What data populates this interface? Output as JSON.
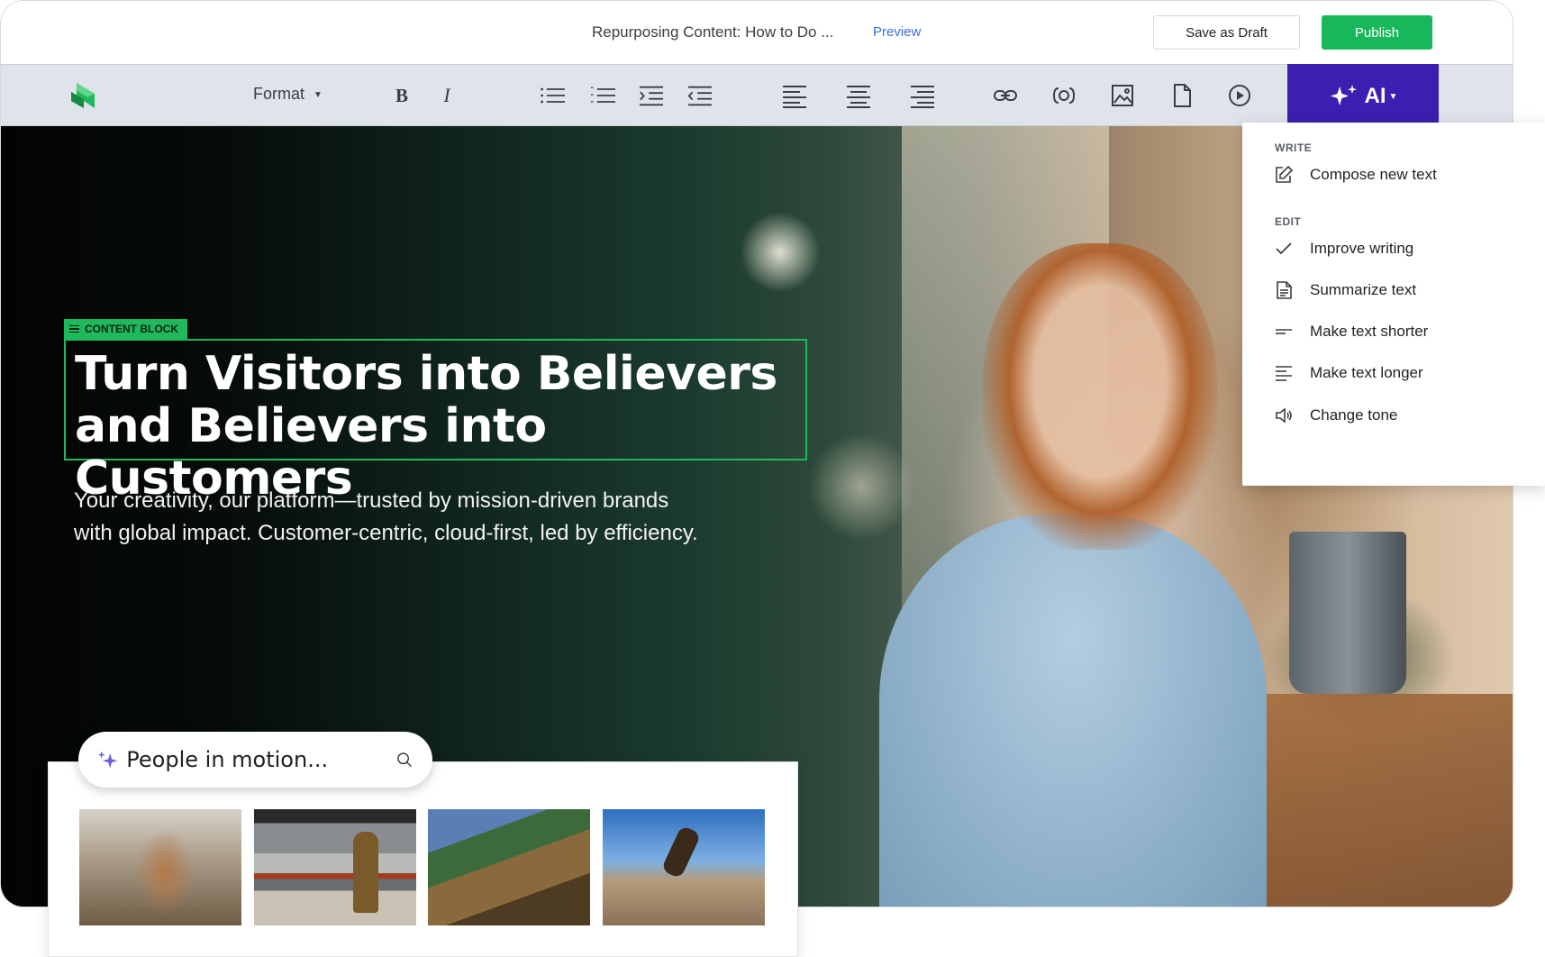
{
  "topbar": {
    "document_title": "Repurposing Content: How to Do ...",
    "preview_label": "Preview",
    "save_draft_label": "Save as Draft",
    "publish_label": "Publish"
  },
  "toolbar": {
    "format_label": "Format",
    "bold_glyph": "B",
    "italic_glyph": "I",
    "ai_label": "AI",
    "icons": [
      "bullet-list",
      "numbered-list",
      "indent",
      "outdent",
      "align-left",
      "align-center",
      "align-right",
      "link",
      "embed",
      "image",
      "document",
      "video"
    ]
  },
  "hero": {
    "tag_label": "CONTENT BLOCK",
    "headline_line1": "Turn Visitors into Believers",
    "headline_line2": "and Believers into Customers",
    "subtext_line1": "Your creativity, our platform—trusted by mission-driven brands",
    "subtext_line2": "with global impact. Customer-centric, cloud-first, led by efficiency."
  },
  "ai_menu": {
    "write_heading": "WRITE",
    "edit_heading": "EDIT",
    "items": [
      {
        "label": "Compose new text",
        "icon": "compose-icon"
      },
      {
        "label": "Improve writing",
        "icon": "check-icon"
      },
      {
        "label": "Summarize text",
        "icon": "summarize-icon"
      },
      {
        "label": "Make text shorter",
        "icon": "shorten-icon"
      },
      {
        "label": "Make text longer",
        "icon": "lengthen-icon"
      },
      {
        "label": "Change tone",
        "icon": "speaker-icon"
      }
    ]
  },
  "image_search": {
    "query": "People in motion...",
    "results": [
      "woman-with-bicycle-in-city",
      "woman-at-subway-platform",
      "person-with-bike-at-structure",
      "skateboarder-jumping"
    ]
  },
  "colors": {
    "accent_purple": "#3a1fb0",
    "publish_green": "#18b85a",
    "content_block_green": "#1fb85a",
    "preview_blue": "#3a6fd8"
  }
}
